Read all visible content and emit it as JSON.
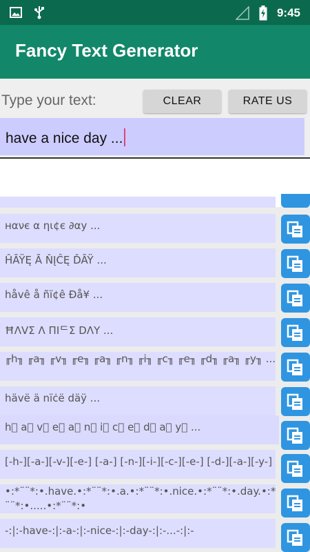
{
  "status": {
    "time": "9:45"
  },
  "app": {
    "title": "Fancy Text Generator"
  },
  "controls": {
    "prompt": "Type your text:",
    "clear_label": "CLEAR",
    "rate_label": "RATE US",
    "input_value": "have a nice day ..."
  },
  "results": [
    "нανє α ηι¢є ∂αу ...",
    "ĤĀŸĘ Ā ŇĮĈĘ ĎĀŸ ...",
    "håvê å ñï¢ê Ðå¥ ...",
    "ĦΛVΣ Λ ПIᄃΣ DΛY ...",
    "╓h╖ ╓a╖ ╓v╖ ╓e╖ ╓a╖ ╓n╖ ╓i╖ ╓c╖ ╓e╖ ╓d╖ ╓a╖ ╓y╖ ...",
    "hävë ä nïċë däÿ ...",
    "h⃣ a⃣ v⃣ e⃣ a⃣ n⃣ i⃣ c⃣ e⃣ d⃣ a⃣ y⃣ ...",
    "[-h-][-a-][-v-][-e-] [-a-] [-n-][-i-][-c-][-e-] [-d-][-a-][-y-] ...",
    "•:*¨¨*:•.have.•:*¨¨*:•.a.•:*¨¨*:•.nice.•:*¨¨*:•.day.•:*¨¨*:•.....•:*¨¨*:•",
    "-:|:-have-:|:-a-:|:-nice-:|:-day-:|:-...-:|:-"
  ]
}
